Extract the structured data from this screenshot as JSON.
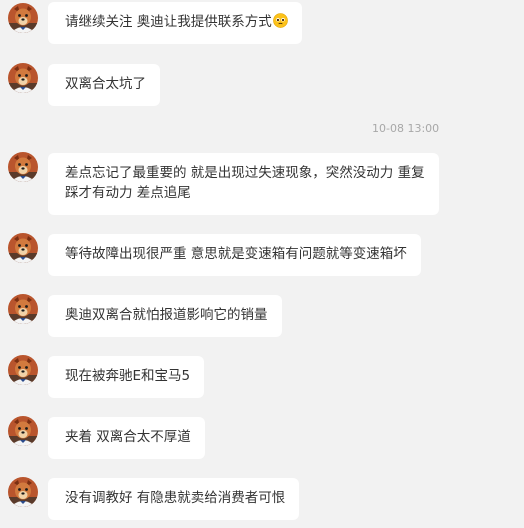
{
  "chat": {
    "messages": [
      {
        "text": "请继续关注 奥迪让我提供联系方式",
        "emoji": "pleading-face-emoji"
      },
      {
        "text": "双离合太坑了"
      },
      {
        "text": "差点忘记了最重要的 就是出现过失速现象，突然没动力 重复踩才有动力 差点追尾"
      },
      {
        "text": "等待故障出现很严重 意思就是变速箱有问题就等变速箱坏"
      },
      {
        "text": "奥迪双离合就怕报道影响它的销量"
      },
      {
        "text": "现在被奔驰E和宝马5"
      },
      {
        "text": "夹着 双离合太不厚道"
      },
      {
        "text": "没有调教好 有隐患就卖给消费者可恨"
      }
    ],
    "timestamp": "10-08 13:00"
  },
  "colors": {
    "background": "#f2f2f2",
    "bubble": "#ffffff",
    "text": "#333333",
    "timestamp": "#a8a8a8"
  }
}
